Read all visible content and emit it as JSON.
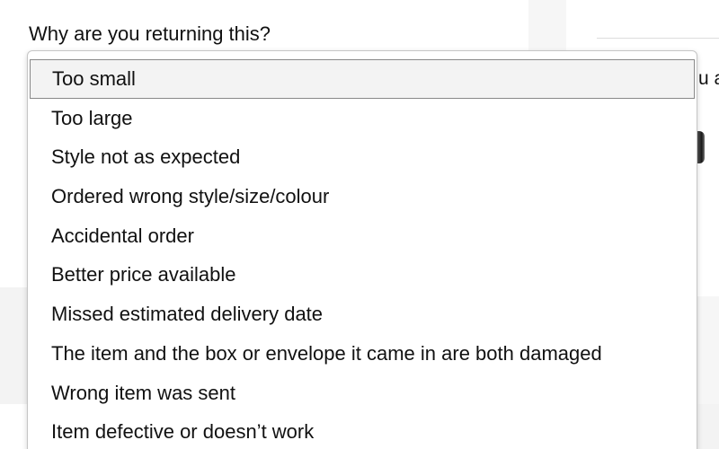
{
  "background": {
    "partial_text": "u a"
  },
  "return_form": {
    "question": "Why are you returning this?",
    "selected_index": 0,
    "options": [
      "Too small",
      "Too large",
      "Style not as expected",
      "Ordered wrong style/size/colour",
      "Accidental order",
      "Better price available",
      "Missed estimated delivery date",
      "The item and the box or envelope it came in are both damaged",
      "Wrong item was sent",
      "Item defective or doesn’t work"
    ]
  }
}
